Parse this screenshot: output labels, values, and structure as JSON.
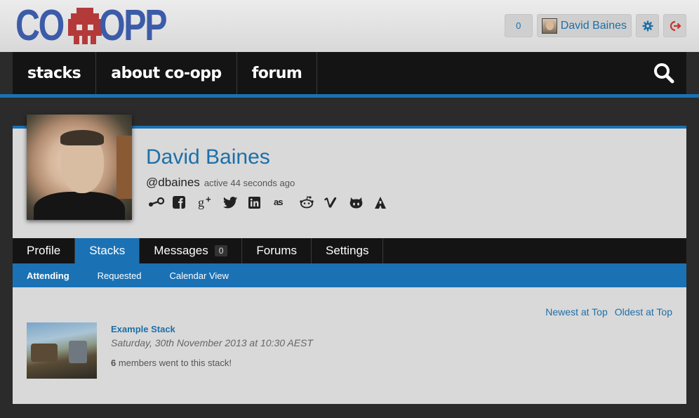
{
  "header": {
    "logo_left": "CO",
    "logo_right": "OPP",
    "notifications_count": "0",
    "user_name": "David Baines"
  },
  "colors": {
    "brand_blue": "#1a72b5",
    "logo_blue": "#3c5ba9",
    "logo_red": "#b43a3a",
    "link_blue": "#1d6fa8",
    "nav_bg": "#141414"
  },
  "nav": {
    "items": [
      {
        "label": "stacks"
      },
      {
        "label": "about co-opp"
      },
      {
        "label": "forum"
      }
    ]
  },
  "profile": {
    "name": "David Baines",
    "handle": "@dbaines",
    "activity": "active 44 seconds ago",
    "socials": [
      "steam-icon",
      "facebook-icon",
      "google-plus-icon",
      "twitter-icon",
      "linkedin-icon",
      "lastfm-icon",
      "reddit-icon",
      "vimeo-icon",
      "github-icon",
      "arma-icon"
    ]
  },
  "tabs": {
    "items": [
      {
        "label": "Profile"
      },
      {
        "label": "Stacks"
      },
      {
        "label": "Messages",
        "badge": "0"
      },
      {
        "label": "Forums"
      },
      {
        "label": "Settings"
      }
    ],
    "active": "Stacks"
  },
  "subtabs": {
    "items": [
      {
        "label": "Attending"
      },
      {
        "label": "Requested"
      },
      {
        "label": "Calendar View"
      }
    ],
    "active": "Attending"
  },
  "sort": {
    "newest": "Newest at Top",
    "oldest": "Oldest at Top"
  },
  "stack": {
    "title": "Example Stack",
    "date": "Saturday, 30th November 2013 at 10:30 AEST",
    "members_count": "6",
    "members_text": " members went to this stack!"
  }
}
